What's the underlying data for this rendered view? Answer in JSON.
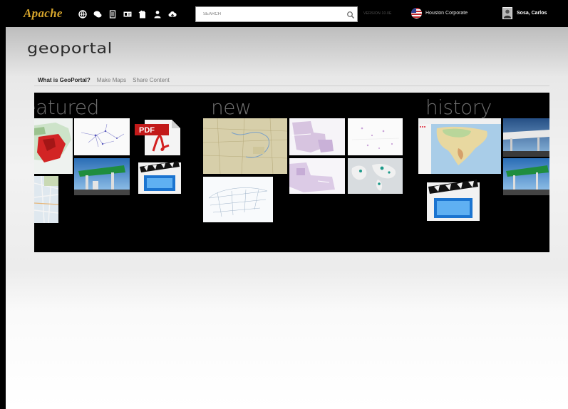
{
  "topbar": {
    "logo": "Apache",
    "icons": [
      "globe-icon",
      "chat-icon",
      "document-icon",
      "id-card-icon",
      "clipboard-icon",
      "people-icon",
      "upload-cloud-icon"
    ],
    "search": {
      "placeholder": "SEARCH"
    },
    "version": "VERSION 10.0E",
    "organization": "Houston Corporate",
    "user": "Sosa, Carlos"
  },
  "brand": "geoportal",
  "subnav": [
    "What is GeoPortal?",
    "Make Maps",
    "Share Content"
  ],
  "carousel": {
    "groups": [
      {
        "title": "featured"
      },
      {
        "title": "new"
      },
      {
        "title": "history"
      }
    ],
    "pdf_label": "PDF"
  }
}
